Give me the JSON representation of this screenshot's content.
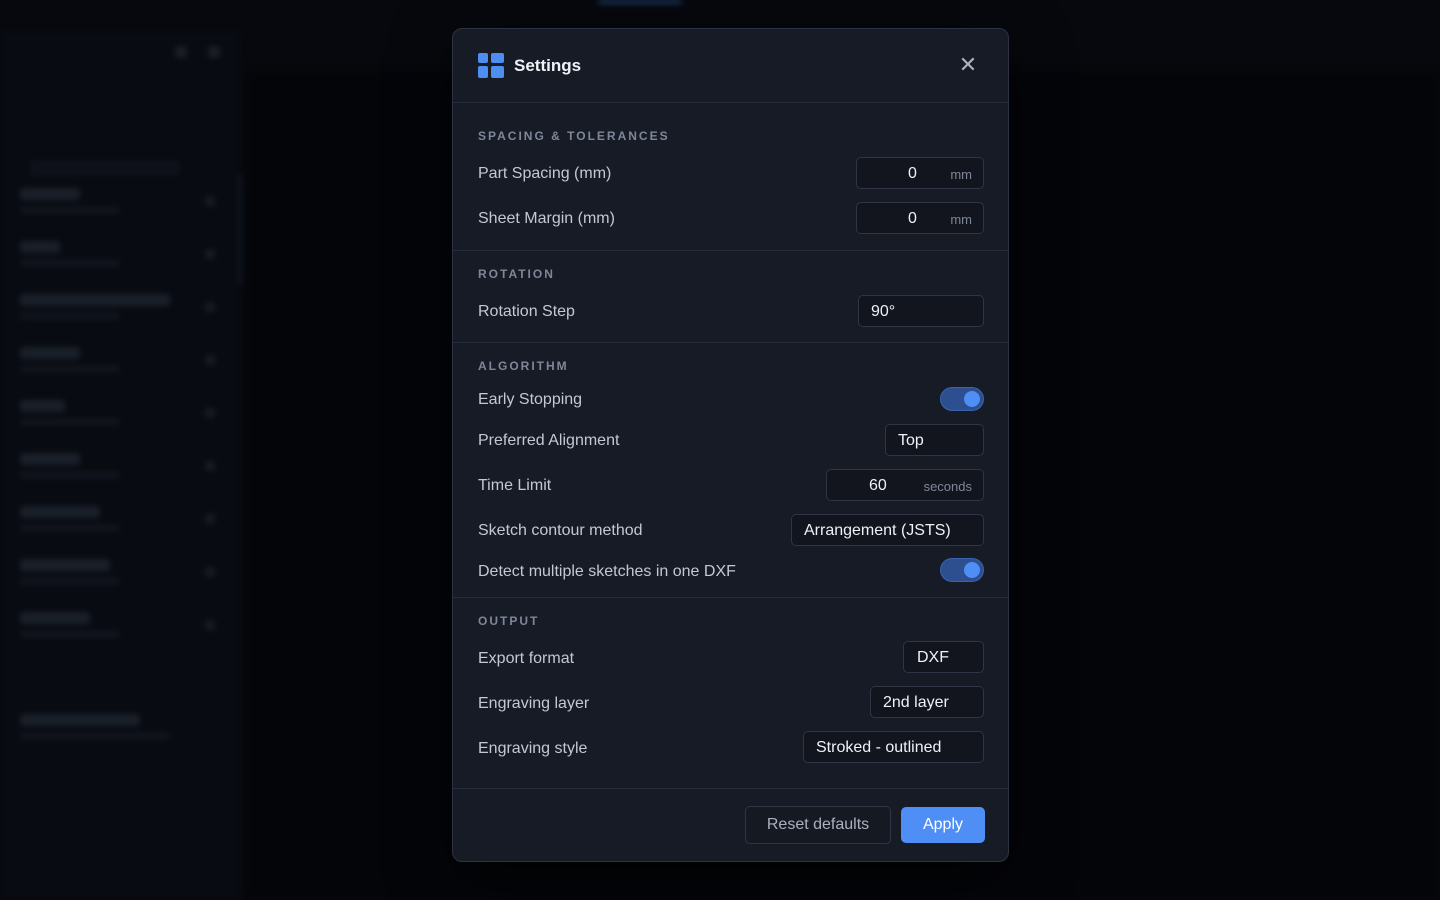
{
  "dialog": {
    "title": "Settings",
    "close_icon": "close-icon",
    "logo_icon": "app-logo-icon",
    "accent_color": "#4f8ff5"
  },
  "sections": {
    "spacing": {
      "title": "SPACING & TOLERANCES",
      "part_spacing": {
        "label": "Part Spacing (mm)",
        "value": "0",
        "unit": "mm"
      },
      "sheet_margin": {
        "label": "Sheet Margin (mm)",
        "value": "0",
        "unit": "mm"
      }
    },
    "rotation": {
      "title": "ROTATION",
      "rotation_step": {
        "label": "Rotation Step",
        "value": "90°"
      }
    },
    "algorithm": {
      "title": "ALGORITHM",
      "early_stopping": {
        "label": "Early Stopping",
        "enabled": true
      },
      "preferred_alignment": {
        "label": "Preferred Alignment",
        "value": "Top"
      },
      "time_limit": {
        "label": "Time Limit",
        "value": "60",
        "unit": "seconds"
      },
      "sketch_contour": {
        "label": "Sketch contour method",
        "value": "Arrangement (JSTS)"
      },
      "detect_multiple": {
        "label": "Detect multiple sketches in one DXF",
        "enabled": true
      }
    },
    "output": {
      "title": "OUTPUT",
      "export_format": {
        "label": "Export format",
        "value": "DXF"
      },
      "engraving_layer": {
        "label": "Engraving layer",
        "value": "2nd layer"
      },
      "engraving_style": {
        "label": "Engraving style",
        "value": "Stroked - outlined"
      }
    }
  },
  "footer": {
    "reset_label": "Reset defaults",
    "apply_label": "Apply"
  }
}
